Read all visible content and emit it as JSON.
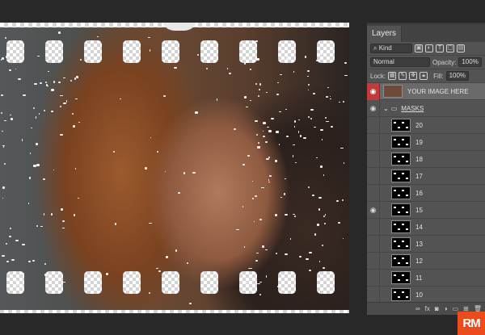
{
  "panel": {
    "tab": "Layers",
    "filter_kind": "Kind",
    "blend_mode": "Normal",
    "opacity_label": "Opacity:",
    "opacity_value": "100%",
    "lock_label": "Lock:",
    "fill_label": "Fill:",
    "fill_value": "100%"
  },
  "layers": [
    {
      "name": "YOUR IMAGE HERE",
      "visible": true,
      "selected": true
    },
    {
      "name": "MASKS",
      "visible": true,
      "group": true
    },
    {
      "name": "20",
      "visible": false
    },
    {
      "name": "19",
      "visible": false
    },
    {
      "name": "18",
      "visible": false
    },
    {
      "name": "17",
      "visible": false
    },
    {
      "name": "16",
      "visible": false
    },
    {
      "name": "15",
      "visible": true
    },
    {
      "name": "14",
      "visible": false
    },
    {
      "name": "13",
      "visible": false
    },
    {
      "name": "12",
      "visible": false
    },
    {
      "name": "11",
      "visible": false
    },
    {
      "name": "10",
      "visible": false
    }
  ],
  "logo": "RM",
  "colors": {
    "selected_eye": "#c43a3a",
    "logo_bg": "#ea4c1e"
  }
}
